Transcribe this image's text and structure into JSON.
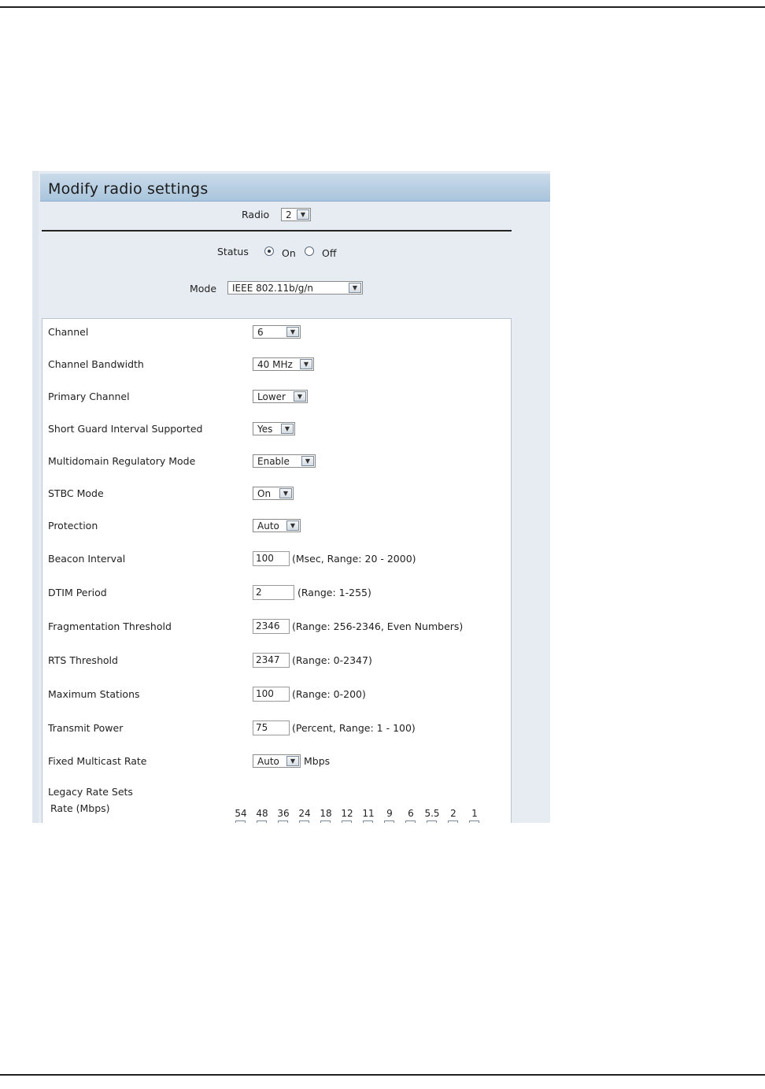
{
  "panel": {
    "title": "Modify radio settings"
  },
  "radio": {
    "label": "Radio",
    "value": "2"
  },
  "status": {
    "label": "Status",
    "on_label": "On",
    "off_label": "Off",
    "selected": "On"
  },
  "mode": {
    "label": "Mode",
    "value": "IEEE 802.11b/g/n"
  },
  "settings": {
    "channel": {
      "label": "Channel",
      "value": "6"
    },
    "channel_bandwidth": {
      "label": "Channel Bandwidth",
      "value": "40 MHz"
    },
    "primary_channel": {
      "label": "Primary Channel",
      "value": "Lower"
    },
    "short_guard": {
      "label": "Short Guard Interval Supported",
      "value": "Yes"
    },
    "multidomain": {
      "label": "Multidomain Regulatory Mode",
      "value": "Enable"
    },
    "stbc": {
      "label": "STBC Mode",
      "value": "On"
    },
    "protection": {
      "label": "Protection",
      "value": "Auto"
    },
    "beacon_interval": {
      "label": "Beacon Interval",
      "value": "100",
      "hint": "(Msec, Range: 20 - 2000)"
    },
    "dtim_period": {
      "label": "DTIM Period",
      "value": "2",
      "hint": "(Range: 1-255)"
    },
    "fragmentation": {
      "label": "Fragmentation Threshold",
      "value": "2346",
      "hint": "(Range: 256-2346, Even Numbers)"
    },
    "rts": {
      "label": "RTS Threshold",
      "value": "2347",
      "hint": "(Range: 0-2347)"
    },
    "max_stations": {
      "label": "Maximum Stations",
      "value": "100",
      "hint": "(Range: 0-200)"
    },
    "transmit_power": {
      "label": "Transmit Power",
      "value": "75",
      "hint": "(Percent, Range: 1 - 100)"
    },
    "fixed_multicast": {
      "label": "Fixed Multicast Rate",
      "value": "Auto",
      "unit": "Mbps"
    }
  },
  "legacy": {
    "title": "Legacy Rate Sets",
    "rate_label": "Rate (Mbps)",
    "rates": [
      "54",
      "48",
      "36",
      "24",
      "18",
      "12",
      "11",
      "9",
      "6",
      "5.5",
      "2",
      "1"
    ]
  }
}
